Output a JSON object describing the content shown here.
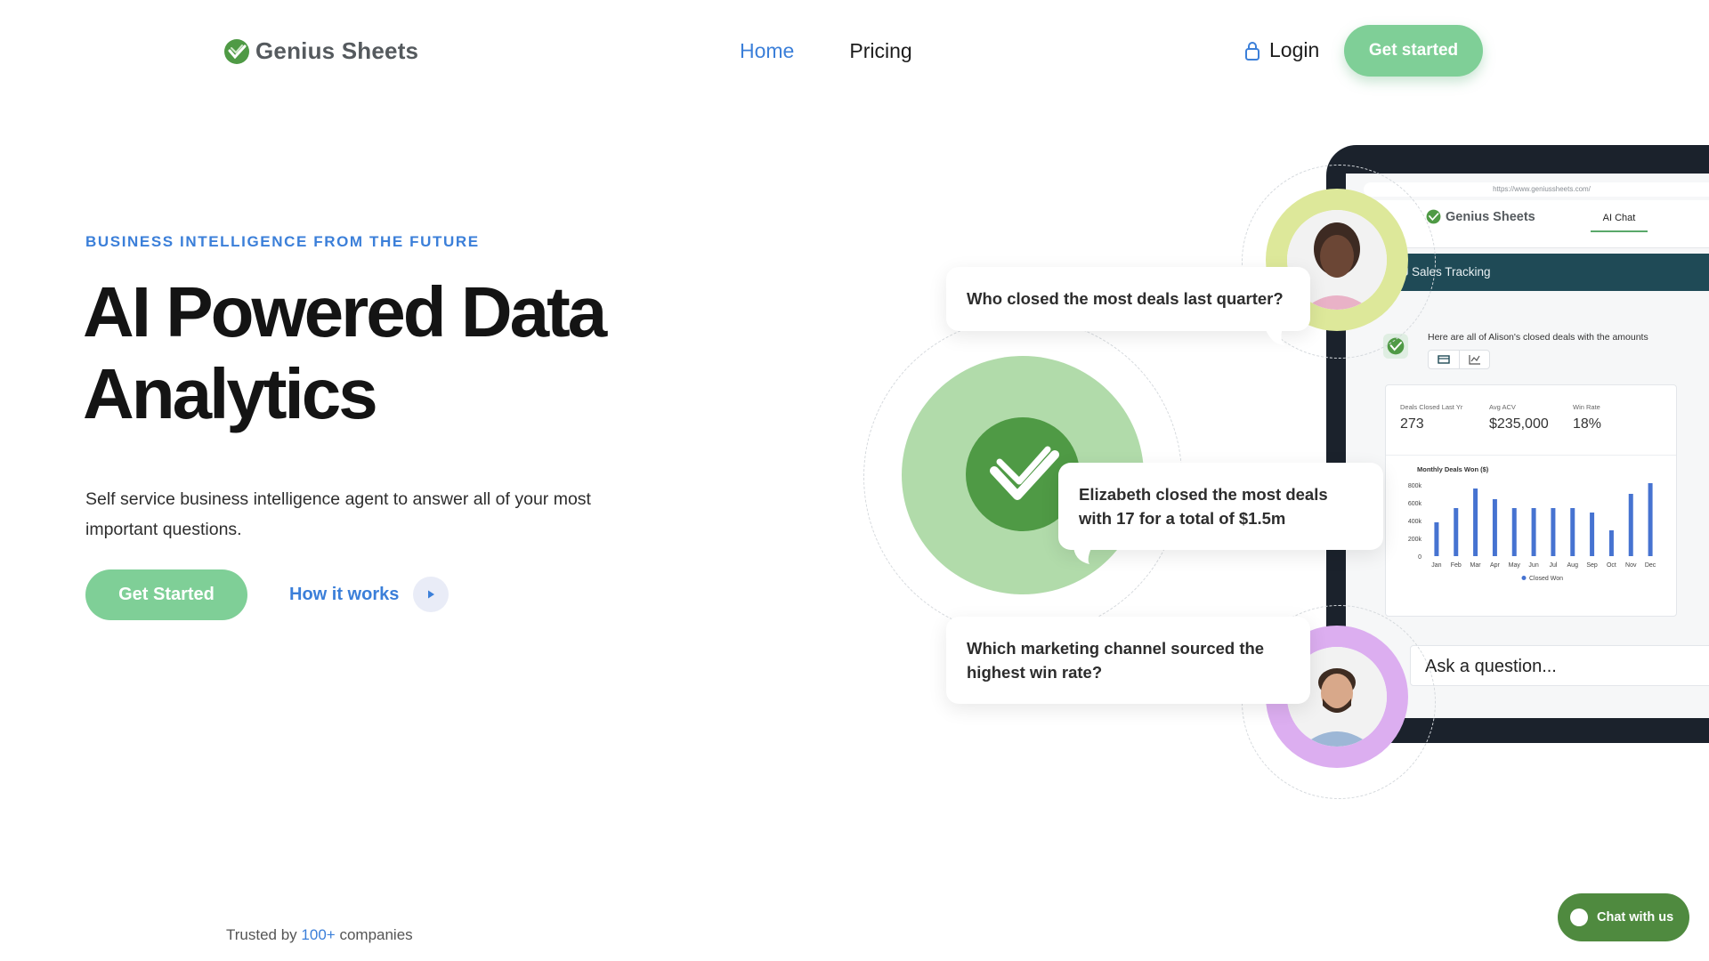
{
  "nav": {
    "logo_text": "Genius Sheets",
    "links": [
      {
        "label": "Home",
        "active": true
      },
      {
        "label": "Pricing",
        "active": false
      }
    ],
    "login_label": "Login",
    "cta_label": "Get started"
  },
  "hero": {
    "eyebrow": "BUSINESS INTELLIGENCE FROM THE FUTURE",
    "title_line1": "AI Powered Data",
    "title_line2": "Analytics",
    "subtitle": "Self service business intelligence agent to answer all of your most important questions.",
    "cta_label": "Get Started",
    "secondary_label": "How it works"
  },
  "trusted": {
    "prefix": "Trusted by",
    "highlight": "100+",
    "suffix": "companies"
  },
  "bubbles": {
    "q1": "Who closed the most deals last quarter?",
    "answer": "Elizabeth closed the most deals with 17 for a total of $1.5m",
    "q2": "Which marketing channel sourced the highest win rate?"
  },
  "app": {
    "url": "https://www.geniussheets.com/",
    "logo_text": "Genius Sheets",
    "tab_label": "AI Chat",
    "section_title": "Sales Tracking",
    "bot_message": "Here are all of Alison's closed deals with the amounts",
    "kpis": [
      {
        "label": "Deals Closed Last Yr",
        "value": "273"
      },
      {
        "label": "Avg ACV",
        "value": "$235,000"
      },
      {
        "label": "Win Rate",
        "value": "18%"
      }
    ],
    "ask_placeholder": "Ask a question..."
  },
  "chat_widget_label": "Chat with us",
  "colors": {
    "accent": "#3b7fd9",
    "brand_green": "#7fcf97",
    "dark_green": "#4f9a45",
    "bar": "#4673d1"
  },
  "chart_data": {
    "type": "bar",
    "title": "Monthly Deals Won ($)",
    "categories": [
      "Jan",
      "Feb",
      "Mar",
      "Apr",
      "May",
      "Jun",
      "Jul",
      "Aug",
      "Sep",
      "Oct",
      "Nov",
      "Dec"
    ],
    "series": [
      {
        "name": "Closed Won",
        "values": [
          380000,
          540000,
          760000,
          640000,
          540000,
          540000,
          540000,
          540000,
          490000,
          290000,
          700000,
          820000
        ]
      }
    ],
    "yticks": [
      "800k",
      "600k",
      "400k",
      "200k",
      "0"
    ],
    "ylim": [
      0,
      800000
    ],
    "legend_position": "bottom"
  }
}
